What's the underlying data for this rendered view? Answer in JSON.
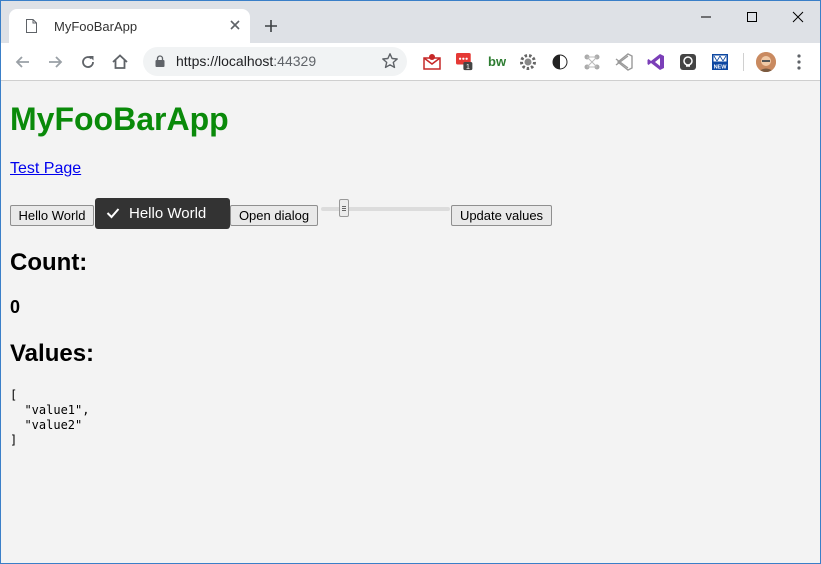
{
  "browser": {
    "tab_title": "MyFooBarApp",
    "url_host": "https://localhost",
    "url_port": ":44329",
    "extension_badge": "1",
    "colors": {
      "accent_border": "#3a7fc8",
      "tabstrip": "#dee1e6"
    }
  },
  "icons": {
    "tab": [
      "page-icon",
      "close-icon",
      "plus-icon"
    ],
    "window": [
      "minimize-icon",
      "maximize-icon",
      "close-window-icon"
    ],
    "nav": [
      "back-icon",
      "forward-icon",
      "reload-icon",
      "home-icon",
      "lock-icon",
      "star-icon"
    ],
    "extensions": [
      "mail-icon",
      "meetup-icon",
      "bw-icon",
      "gear-icon",
      "contrast-icon",
      "network-icon",
      "vscode-icon",
      "visualstudio-icon",
      "lightbulb-icon",
      "new-icon",
      "avatar",
      "menu-icon"
    ]
  },
  "app": {
    "title": "MyFooBarApp",
    "title_color": "#0a8a0a",
    "test_link": "Test Page",
    "hello_button_label": "Hello World",
    "hello_toggle_label": "Hello World",
    "open_dialog_label": "Open dialog",
    "slider_value_fraction": 0.15,
    "update_values_label": "Update values",
    "count_heading": "Count:",
    "count_value": "0",
    "values_heading": "Values:",
    "values_text": "[\n  \"value1\",\n  \"value2\"\n]"
  }
}
